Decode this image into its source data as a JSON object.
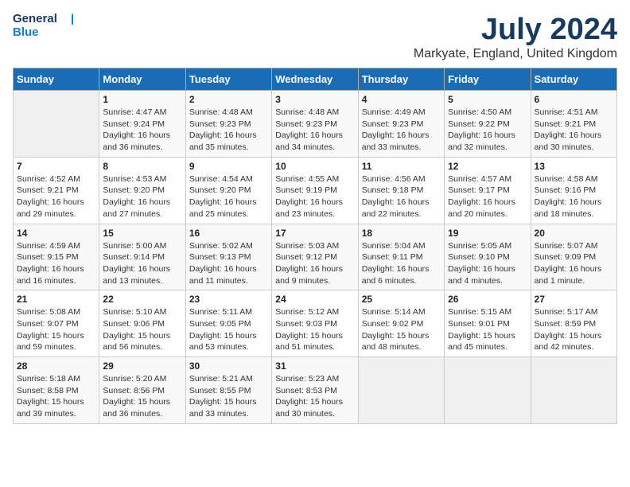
{
  "header": {
    "logo_line1": "General",
    "logo_line2": "Blue",
    "month": "July 2024",
    "location": "Markyate, England, United Kingdom"
  },
  "weekdays": [
    "Sunday",
    "Monday",
    "Tuesday",
    "Wednesday",
    "Thursday",
    "Friday",
    "Saturday"
  ],
  "weeks": [
    [
      {
        "day": "",
        "info": ""
      },
      {
        "day": "1",
        "info": "Sunrise: 4:47 AM\nSunset: 9:24 PM\nDaylight: 16 hours\nand 36 minutes."
      },
      {
        "day": "2",
        "info": "Sunrise: 4:48 AM\nSunset: 9:23 PM\nDaylight: 16 hours\nand 35 minutes."
      },
      {
        "day": "3",
        "info": "Sunrise: 4:48 AM\nSunset: 9:23 PM\nDaylight: 16 hours\nand 34 minutes."
      },
      {
        "day": "4",
        "info": "Sunrise: 4:49 AM\nSunset: 9:23 PM\nDaylight: 16 hours\nand 33 minutes."
      },
      {
        "day": "5",
        "info": "Sunrise: 4:50 AM\nSunset: 9:22 PM\nDaylight: 16 hours\nand 32 minutes."
      },
      {
        "day": "6",
        "info": "Sunrise: 4:51 AM\nSunset: 9:21 PM\nDaylight: 16 hours\nand 30 minutes."
      }
    ],
    [
      {
        "day": "7",
        "info": "Sunrise: 4:52 AM\nSunset: 9:21 PM\nDaylight: 16 hours\nand 29 minutes."
      },
      {
        "day": "8",
        "info": "Sunrise: 4:53 AM\nSunset: 9:20 PM\nDaylight: 16 hours\nand 27 minutes."
      },
      {
        "day": "9",
        "info": "Sunrise: 4:54 AM\nSunset: 9:20 PM\nDaylight: 16 hours\nand 25 minutes."
      },
      {
        "day": "10",
        "info": "Sunrise: 4:55 AM\nSunset: 9:19 PM\nDaylight: 16 hours\nand 23 minutes."
      },
      {
        "day": "11",
        "info": "Sunrise: 4:56 AM\nSunset: 9:18 PM\nDaylight: 16 hours\nand 22 minutes."
      },
      {
        "day": "12",
        "info": "Sunrise: 4:57 AM\nSunset: 9:17 PM\nDaylight: 16 hours\nand 20 minutes."
      },
      {
        "day": "13",
        "info": "Sunrise: 4:58 AM\nSunset: 9:16 PM\nDaylight: 16 hours\nand 18 minutes."
      }
    ],
    [
      {
        "day": "14",
        "info": "Sunrise: 4:59 AM\nSunset: 9:15 PM\nDaylight: 16 hours\nand 16 minutes."
      },
      {
        "day": "15",
        "info": "Sunrise: 5:00 AM\nSunset: 9:14 PM\nDaylight: 16 hours\nand 13 minutes."
      },
      {
        "day": "16",
        "info": "Sunrise: 5:02 AM\nSunset: 9:13 PM\nDaylight: 16 hours\nand 11 minutes."
      },
      {
        "day": "17",
        "info": "Sunrise: 5:03 AM\nSunset: 9:12 PM\nDaylight: 16 hours\nand 9 minutes."
      },
      {
        "day": "18",
        "info": "Sunrise: 5:04 AM\nSunset: 9:11 PM\nDaylight: 16 hours\nand 6 minutes."
      },
      {
        "day": "19",
        "info": "Sunrise: 5:05 AM\nSunset: 9:10 PM\nDaylight: 16 hours\nand 4 minutes."
      },
      {
        "day": "20",
        "info": "Sunrise: 5:07 AM\nSunset: 9:09 PM\nDaylight: 16 hours\nand 1 minute."
      }
    ],
    [
      {
        "day": "21",
        "info": "Sunrise: 5:08 AM\nSunset: 9:07 PM\nDaylight: 15 hours\nand 59 minutes."
      },
      {
        "day": "22",
        "info": "Sunrise: 5:10 AM\nSunset: 9:06 PM\nDaylight: 15 hours\nand 56 minutes."
      },
      {
        "day": "23",
        "info": "Sunrise: 5:11 AM\nSunset: 9:05 PM\nDaylight: 15 hours\nand 53 minutes."
      },
      {
        "day": "24",
        "info": "Sunrise: 5:12 AM\nSunset: 9:03 PM\nDaylight: 15 hours\nand 51 minutes."
      },
      {
        "day": "25",
        "info": "Sunrise: 5:14 AM\nSunset: 9:02 PM\nDaylight: 15 hours\nand 48 minutes."
      },
      {
        "day": "26",
        "info": "Sunrise: 5:15 AM\nSunset: 9:01 PM\nDaylight: 15 hours\nand 45 minutes."
      },
      {
        "day": "27",
        "info": "Sunrise: 5:17 AM\nSunset: 8:59 PM\nDaylight: 15 hours\nand 42 minutes."
      }
    ],
    [
      {
        "day": "28",
        "info": "Sunrise: 5:18 AM\nSunset: 8:58 PM\nDaylight: 15 hours\nand 39 minutes."
      },
      {
        "day": "29",
        "info": "Sunrise: 5:20 AM\nSunset: 8:56 PM\nDaylight: 15 hours\nand 36 minutes."
      },
      {
        "day": "30",
        "info": "Sunrise: 5:21 AM\nSunset: 8:55 PM\nDaylight: 15 hours\nand 33 minutes."
      },
      {
        "day": "31",
        "info": "Sunrise: 5:23 AM\nSunset: 8:53 PM\nDaylight: 15 hours\nand 30 minutes."
      },
      {
        "day": "",
        "info": ""
      },
      {
        "day": "",
        "info": ""
      },
      {
        "day": "",
        "info": ""
      }
    ]
  ]
}
